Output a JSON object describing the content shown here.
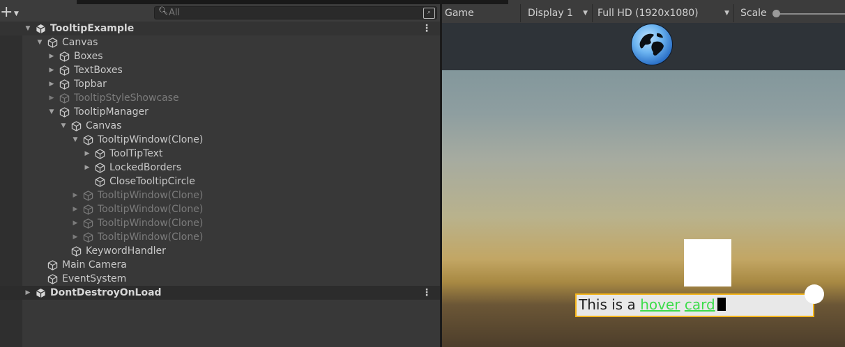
{
  "hierarchy": {
    "create_icon": "plus-icon",
    "search": {
      "placeholder": "All",
      "value": ""
    },
    "rows": [
      {
        "depth": 0,
        "expanded": true,
        "icon": "unity-scene-icon",
        "label": "TooltipExample",
        "scene": true,
        "menu": "⋮"
      },
      {
        "depth": 1,
        "expanded": true,
        "icon": "cube-icon",
        "label": "Canvas"
      },
      {
        "depth": 2,
        "expanded": false,
        "icon": "cube-icon",
        "label": "Boxes"
      },
      {
        "depth": 2,
        "expanded": false,
        "icon": "cube-icon",
        "label": "TextBoxes"
      },
      {
        "depth": 2,
        "expanded": false,
        "icon": "cube-icon",
        "label": "Topbar"
      },
      {
        "depth": 2,
        "expanded": false,
        "icon": "cube-icon",
        "label": "TooltipStyleShowcase",
        "inactive": true
      },
      {
        "depth": 2,
        "expanded": true,
        "icon": "cube-icon",
        "label": "TooltipManager"
      },
      {
        "depth": 3,
        "expanded": true,
        "icon": "cube-icon",
        "label": "Canvas"
      },
      {
        "depth": 4,
        "expanded": true,
        "icon": "cube-icon",
        "label": "TooltipWindow(Clone)"
      },
      {
        "depth": 5,
        "expanded": false,
        "icon": "cube-icon",
        "label": "ToolTipText"
      },
      {
        "depth": 5,
        "expanded": false,
        "icon": "cube-icon",
        "label": "LockedBorders"
      },
      {
        "depth": 5,
        "leaf": true,
        "icon": "cube-icon",
        "label": "CloseTooltipCircle"
      },
      {
        "depth": 4,
        "expanded": false,
        "icon": "cube-icon",
        "label": "TooltipWindow(Clone)",
        "inactive": true
      },
      {
        "depth": 4,
        "expanded": false,
        "icon": "cube-icon",
        "label": "TooltipWindow(Clone)",
        "inactive": true
      },
      {
        "depth": 4,
        "expanded": false,
        "icon": "cube-icon",
        "label": "TooltipWindow(Clone)",
        "inactive": true
      },
      {
        "depth": 4,
        "expanded": false,
        "icon": "cube-icon",
        "label": "TooltipWindow(Clone)",
        "inactive": true
      },
      {
        "depth": 3,
        "leaf": true,
        "icon": "cube-icon",
        "label": "KeywordHandler"
      },
      {
        "depth": 1,
        "leaf": true,
        "icon": "cube-icon",
        "label": "Main Camera"
      },
      {
        "depth": 1,
        "leaf": true,
        "icon": "cube-icon",
        "label": "EventSystem"
      },
      {
        "depth": 0,
        "expanded": false,
        "icon": "unity-scene-icon",
        "label": "DontDestroyOnLoad",
        "separator": true,
        "menu": "⋮"
      }
    ]
  },
  "game": {
    "tab_label": "Game",
    "display": "Display 1",
    "resolution": "Full HD (1920x1080)",
    "scale_label": "Scale",
    "scale_value": 0.0,
    "viewport": {
      "hover_card": {
        "prefix": "This is a ",
        "keyword1": "hover",
        "space": " ",
        "keyword2": "card"
      },
      "colors": {
        "card_border": "#f4b51c",
        "keyword": "#3ddc4a"
      }
    }
  }
}
